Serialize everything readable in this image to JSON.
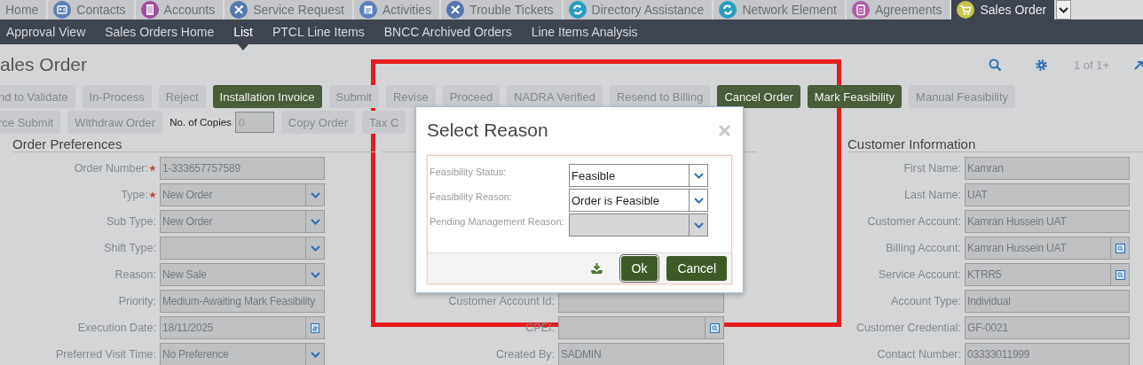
{
  "tabs": [
    {
      "label": "Home",
      "selected": false
    },
    {
      "label": "Contacts",
      "kind": "card",
      "color": "#5b7fb8",
      "selected": false
    },
    {
      "label": "Accounts",
      "kind": "building",
      "color": "#a04f9a",
      "selected": false
    },
    {
      "label": "Service Request",
      "kind": "tools",
      "color": "#5577b0",
      "selected": false
    },
    {
      "label": "Activities",
      "kind": "calendar",
      "color": "#5a7fb8",
      "selected": false
    },
    {
      "label": "Trouble Tickets",
      "kind": "tools",
      "color": "#5577b0",
      "selected": false
    },
    {
      "label": "Directory Assistance",
      "kind": "arrows",
      "color": "#2a9dc4",
      "selected": false
    },
    {
      "label": "Network Element",
      "kind": "arrows",
      "color": "#2a9dc4",
      "selected": false
    },
    {
      "label": "Agreements",
      "kind": "clipboard",
      "color": "#b05aa8",
      "selected": false
    },
    {
      "label": "Sales Order",
      "kind": "cart",
      "color": "#c8c44e",
      "selected": true
    }
  ],
  "subnav": [
    {
      "label": "Approval View",
      "selected": false
    },
    {
      "label": "Sales Orders Home",
      "selected": false
    },
    {
      "label": "List",
      "selected": true
    },
    {
      "label": "PTCL Line Items",
      "selected": false
    },
    {
      "label": "BNCC Archived Orders",
      "selected": false
    },
    {
      "label": "Line Items Analysis",
      "selected": false
    }
  ],
  "page_title": "ales Order",
  "record_counter": "1 of 1+",
  "action_rows": [
    [
      {
        "kind": "button",
        "label": "nd to Validate",
        "enabled": false
      },
      {
        "kind": "button",
        "label": "In-Process",
        "enabled": false
      },
      {
        "kind": "button",
        "label": "Reject",
        "enabled": false
      },
      {
        "kind": "button",
        "label": "Installation Invoice",
        "enabled": true
      },
      {
        "kind": "button",
        "label": "Submit",
        "enabled": false
      },
      {
        "kind": "button",
        "label": "Revise",
        "enabled": false
      },
      {
        "kind": "button",
        "label": "Proceed",
        "enabled": false
      },
      {
        "kind": "button",
        "label": "NADRA Verified",
        "enabled": false
      },
      {
        "kind": "button",
        "label": "Resend to Billing",
        "enabled": false
      },
      {
        "kind": "button",
        "label": "Cancel Order",
        "enabled": true
      },
      {
        "kind": "button",
        "label": "Mark Feasibility",
        "enabled": true
      },
      {
        "kind": "button",
        "label": "Manual Feasibility",
        "enabled": false
      }
    ],
    [
      {
        "kind": "button",
        "label": "rce Submit",
        "enabled": false
      },
      {
        "kind": "button",
        "label": "Withdraw Order",
        "enabled": false
      },
      {
        "kind": "copies",
        "label": "No. of Copies",
        "value": "0"
      },
      {
        "kind": "button",
        "label": "Copy Order",
        "enabled": false
      },
      {
        "kind": "button",
        "label": "Tax C",
        "enabled": false
      }
    ]
  ],
  "sections": [
    {
      "title": "Order Preferences",
      "fields": [
        {
          "label": "Order Number:",
          "required": true,
          "kind": "text",
          "value": "1-333657757589"
        },
        {
          "label": "Type:",
          "required": true,
          "kind": "select",
          "value": "New Order"
        },
        {
          "label": "Sub Type:",
          "required": false,
          "kind": "select",
          "value": "New Order"
        },
        {
          "label": "Shift Type:",
          "required": false,
          "kind": "select"
        },
        {
          "label": "Reason:",
          "required": false,
          "kind": "select",
          "value": "New Sale"
        },
        {
          "label": "Priority:",
          "required": false,
          "kind": "text",
          "value": "Medium-Awaiting Mark Feasibility"
        },
        {
          "label": "Execution Date:",
          "required": false,
          "kind": "date",
          "value": "18/11/2025"
        },
        {
          "label": "Preferred Visit Time:",
          "required": false,
          "kind": "select",
          "value": "No Preference"
        }
      ]
    },
    {
      "fields": [
        {
          "label": "Customer Account Id:",
          "required": false,
          "kind": "text"
        },
        {
          "label": "CPEI:",
          "required": false,
          "kind": "lookup"
        },
        {
          "label": "Created By:",
          "required": false,
          "kind": "text",
          "value": "SADMIN"
        }
      ]
    },
    {
      "title": "Customer Information",
      "fields": [
        {
          "label": "First Name:",
          "required": false,
          "kind": "text",
          "value": "Kamran"
        },
        {
          "label": "Last Name:",
          "required": false,
          "kind": "text",
          "value": "UAT"
        },
        {
          "label": "Customer Account:",
          "required": false,
          "kind": "text",
          "value": "Kamran Hussein UAT"
        },
        {
          "label": "Billing Account:",
          "required": false,
          "kind": "lookup",
          "value": "Kamran Hussein UAT"
        },
        {
          "label": "Service Account:",
          "required": false,
          "kind": "lookup",
          "value": "KTRR5"
        },
        {
          "label": "Account Type:",
          "required": false,
          "kind": "text",
          "value": "Individual"
        },
        {
          "label": "Customer Credential:",
          "required": false,
          "kind": "text",
          "value": "GF-0021"
        },
        {
          "label": "Contact Number:",
          "required": false,
          "kind": "text",
          "value": "03333011999"
        }
      ]
    }
  ],
  "dialog": {
    "title": "Select Reason",
    "fields": [
      {
        "label": "Feasibility Status:",
        "value": "Feasible",
        "disabled": false
      },
      {
        "label": "Feasibility Reason:",
        "value": "Order is Feasible",
        "disabled": false
      },
      {
        "label": "Pending Management Reason:",
        "disabled": true
      }
    ],
    "buttons": [
      {
        "label": "Ok",
        "focused": true
      },
      {
        "label": "Cancel",
        "focused": false
      }
    ]
  }
}
